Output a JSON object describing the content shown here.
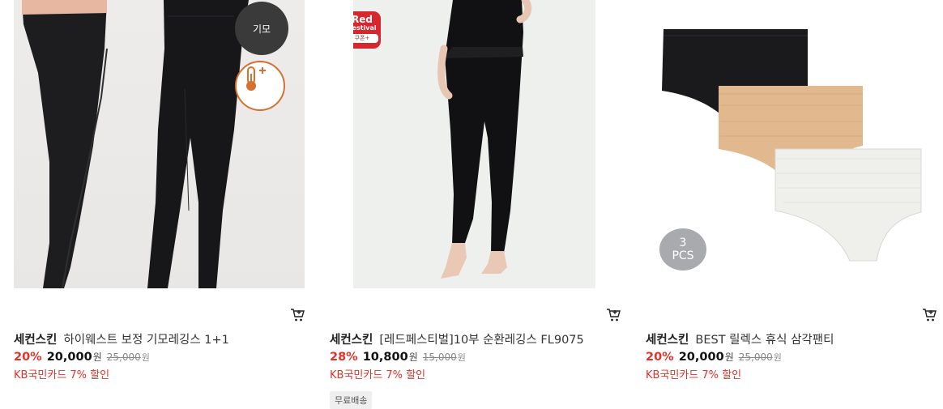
{
  "products": [
    {
      "brand": "세컨스킨",
      "name": "하이웨스트 보정 기모레깅스 1+1",
      "discount": "20%",
      "price": "20,000",
      "currency": "원",
      "original_price": "25,000",
      "card_promo": "KB국민카드 7% 할인",
      "badges": {
        "feature": "기모",
        "icon": "thermometer-plus-icon"
      }
    },
    {
      "brand": "세컨스킨",
      "name": "[레드페스티벌]10부 순환레깅스 FL9075",
      "discount": "28%",
      "price": "10,800",
      "currency": "원",
      "original_price": "15,000",
      "card_promo": "KB국민카드 7% 할인",
      "badges": {
        "event_line1": "Red",
        "event_line2": "Festival",
        "event_line3": "쿠폰+"
      },
      "shipping_tag": "무료배송"
    },
    {
      "brand": "세컨스킨",
      "name": "BEST 릴렉스 휴식 삼각팬티",
      "discount": "20%",
      "price": "20,000",
      "currency": "원",
      "original_price": "25,000",
      "card_promo": "KB국민카드 7% 할인",
      "badges": {
        "count": "3",
        "unit": "PCS"
      }
    }
  ],
  "colors": {
    "accent_red": "#e2322b",
    "text": "#222222"
  }
}
